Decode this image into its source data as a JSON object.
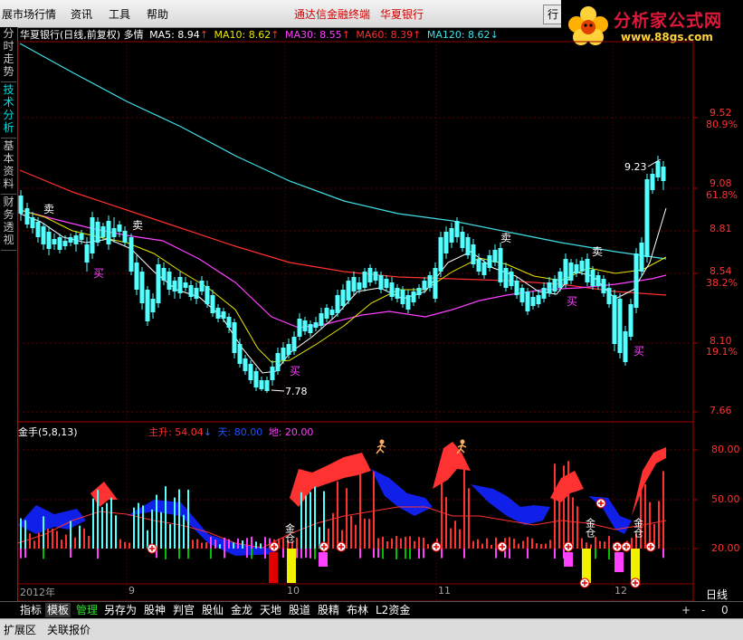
{
  "menubar": {
    "items": [
      "展市场行情",
      "资讯",
      "工具",
      "帮助"
    ],
    "broker": "通达信金融终端",
    "stock": "华夏银行",
    "hang_button": "行"
  },
  "logo": {
    "text": "分析家公式网",
    "url": "www.88gs.com"
  },
  "sidebar": [
    "分时走势",
    "技术分析",
    "基本资料",
    "财务透视"
  ],
  "chart_title": {
    "stock": "华夏银行(日线,前复权)",
    "trend": "多情",
    "ma5_label": "MA5: 8.94",
    "ma5_arrow": "↑",
    "ma10_label": "MA10: 8.62",
    "ma10_arrow": "↑",
    "ma30_label": "MA30: 8.55",
    "ma30_arrow": "↑",
    "ma60_label": "MA60: 8.39",
    "ma60_arrow": "↑",
    "ma120_label": "MA120: 8.62",
    "ma120_arrow": "↓"
  },
  "indicator": {
    "name": "金手(5,8,13)",
    "zhusheng_label": "主升: 54.04",
    "zhusheng_arrow": "↓",
    "tian_label": "天: 80.00",
    "di_label": "地: 20.00"
  },
  "price_ticks": [
    "9.52",
    "80.9%",
    "9.08",
    "61.8%",
    "8.81",
    "8.54",
    "38.2%",
    "8.10",
    "19.1%",
    "7.66"
  ],
  "ind_ticks": [
    "80.00",
    "50.00",
    "20.00"
  ],
  "x_labels": [
    "2012年",
    "9",
    "10",
    "11",
    "12"
  ],
  "period_label": "日线",
  "period_controls": [
    "+",
    "-",
    "0"
  ],
  "price_annotations": {
    "high": "9.23",
    "low": "7.78",
    "sell": "卖",
    "buy": "买",
    "jincang": "金仓"
  },
  "tabs": [
    "指标",
    "模板",
    "管理",
    "另存为",
    "股神",
    "判官",
    "股仙",
    "金龙",
    "天地",
    "股道",
    "股精",
    "布林",
    "L2资金"
  ],
  "bottom": [
    "扩展区",
    "关联报价"
  ],
  "colors": {
    "up": "#ff3232",
    "down": "#54ffff",
    "ma5": "#ffffff",
    "ma10": "#e8e800",
    "ma30": "#ff40ff",
    "ma60": "#ff3030",
    "ma120": "#40e0e8"
  },
  "chart_data": [
    {
      "type": "candlestick",
      "title": "华夏银行(日线,前复权)",
      "y_axis_ticks": [
        9.52,
        9.08,
        8.81,
        8.54,
        8.1,
        7.66
      ],
      "fib_levels": {
        "80.9%": 9.52,
        "61.8%": 9.08,
        "38.2%": 8.54,
        "19.1%": 8.1
      },
      "x_labels": [
        "2012年",
        "9",
        "10",
        "11",
        "12"
      ],
      "annotated_high": 9.23,
      "annotated_low": 7.78,
      "ma_current": {
        "MA5": 8.94,
        "MA10": 8.62,
        "MA30": 8.55,
        "MA60": 8.39,
        "MA120": 8.62
      }
    },
    {
      "type": "bar",
      "title": "金手(5,8,13)",
      "y_axis_ticks": [
        80,
        50,
        20
      ],
      "series": [
        {
          "name": "主升",
          "last_value": 54.04
        },
        {
          "name": "天",
          "last_value": 80.0
        },
        {
          "name": "地",
          "last_value": 20.0
        }
      ]
    }
  ]
}
